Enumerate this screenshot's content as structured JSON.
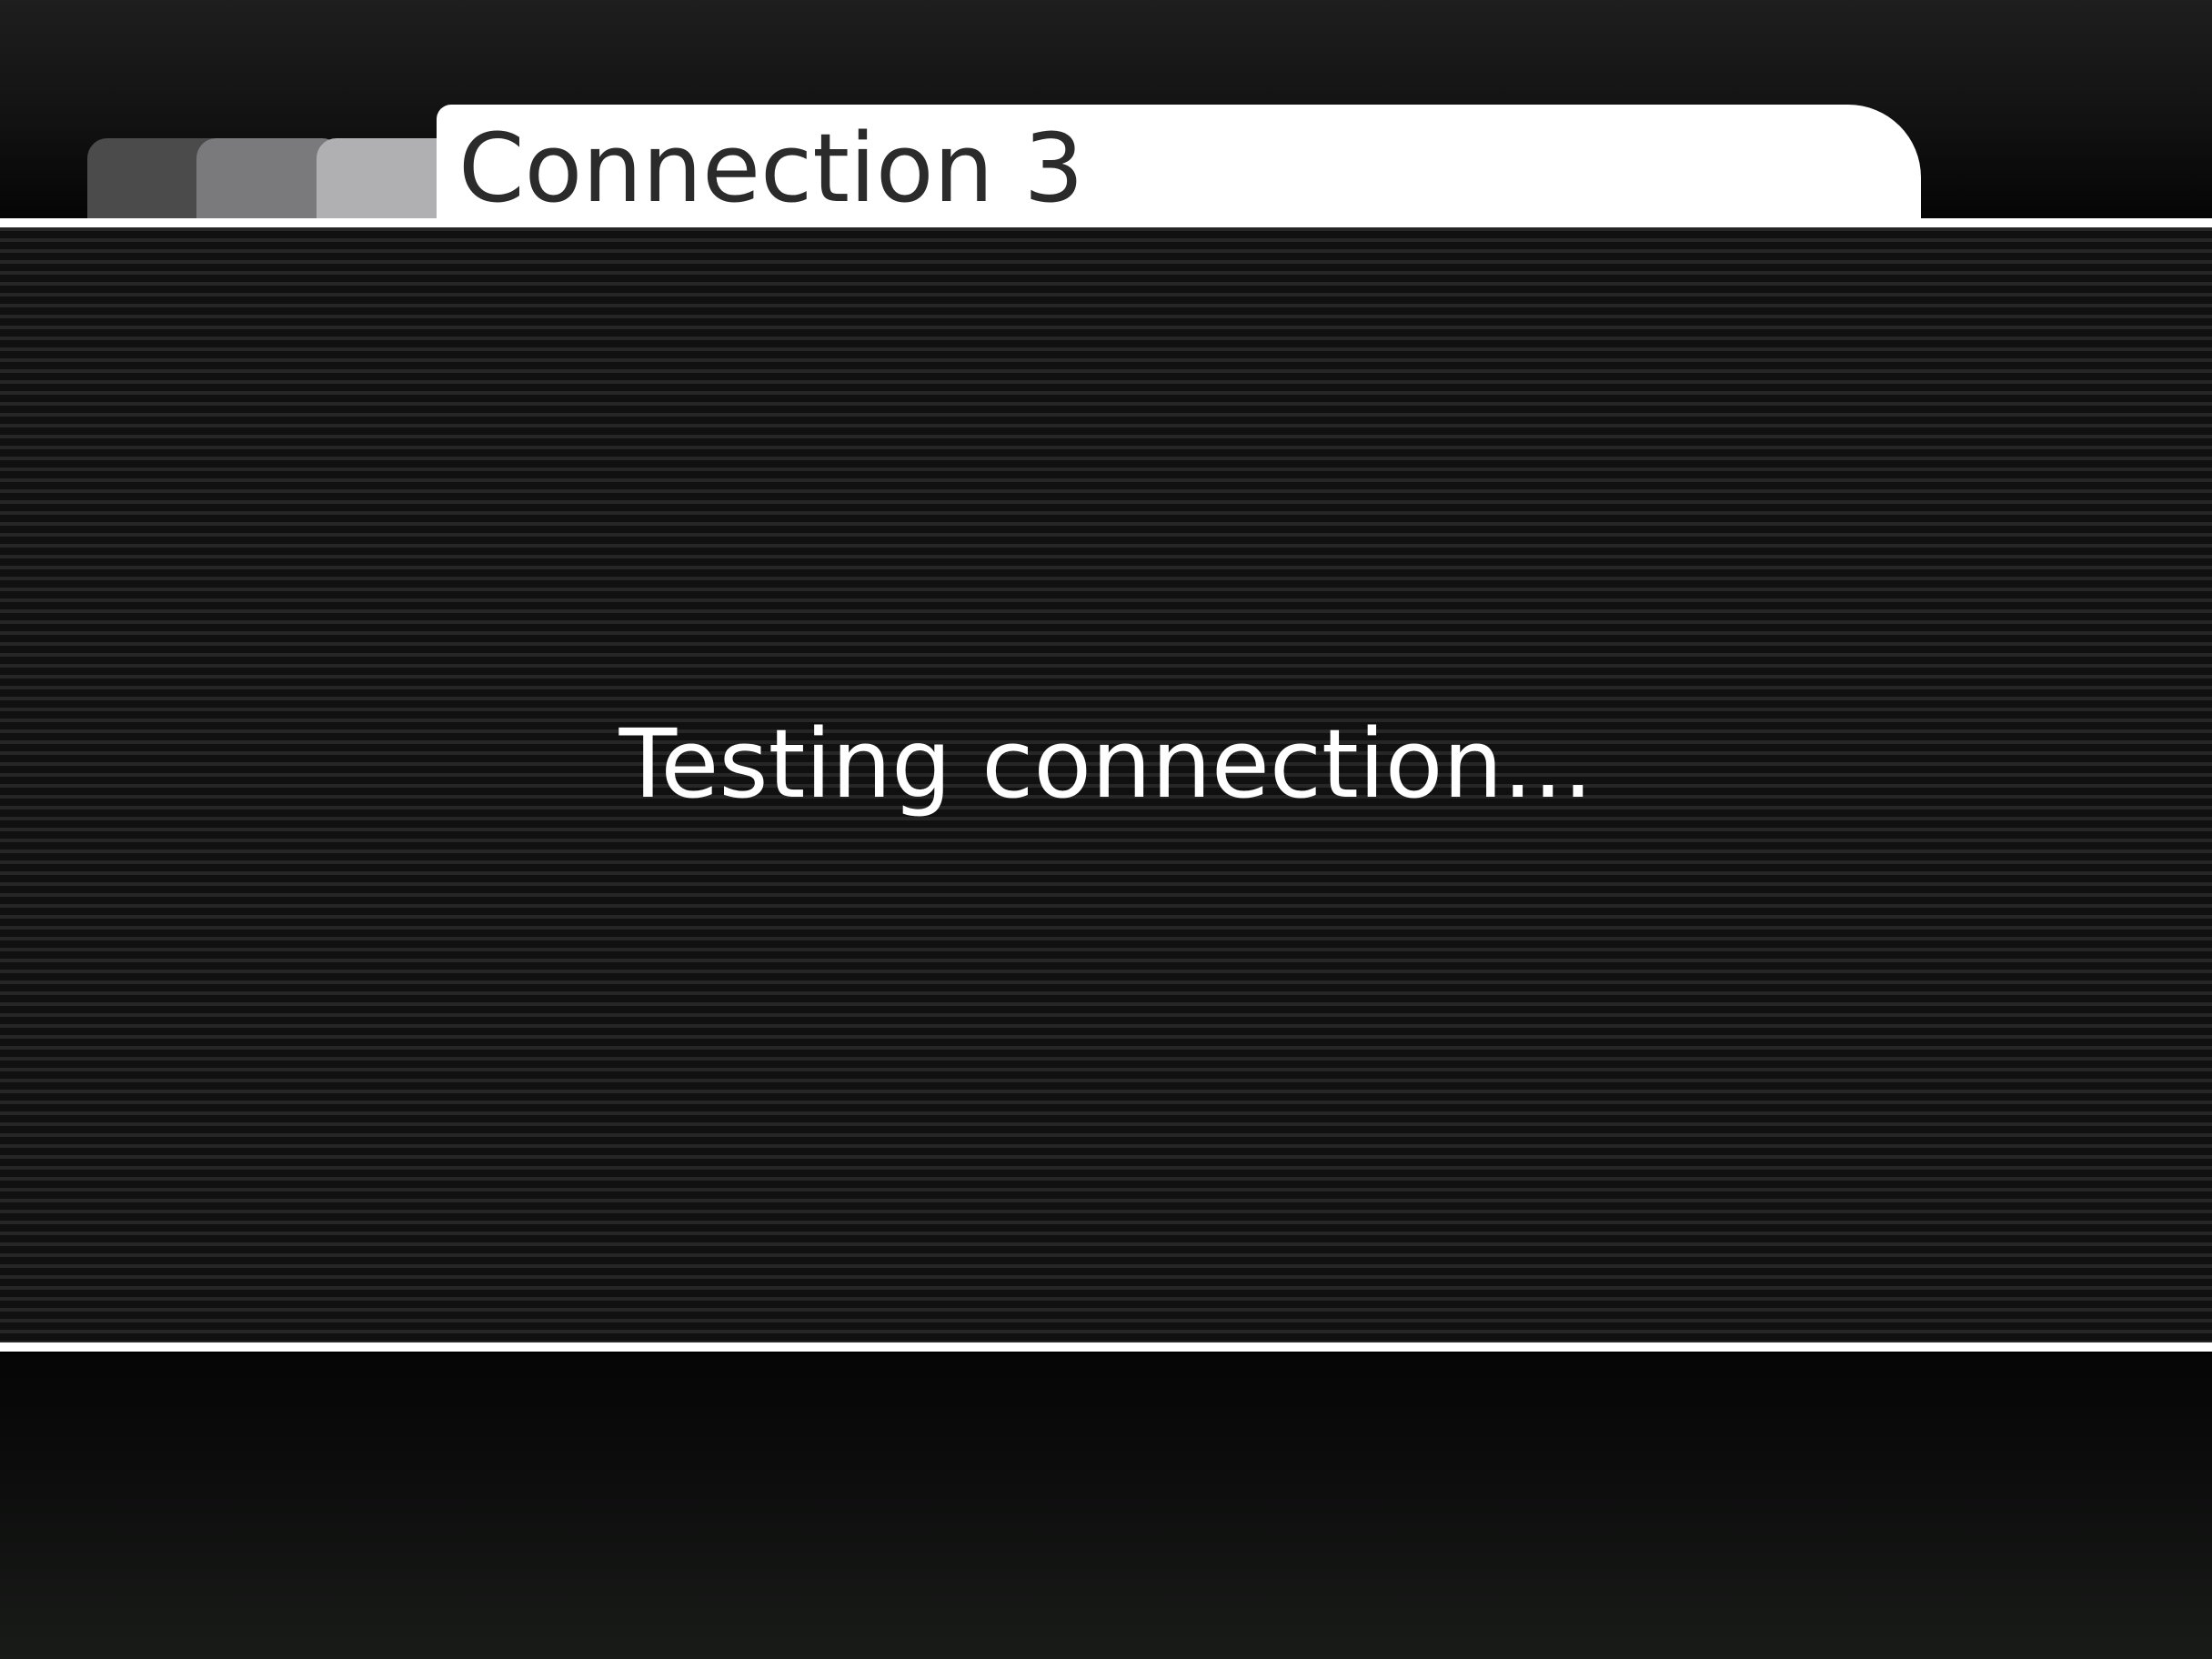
{
  "tab": {
    "title": "Connection 3"
  },
  "status": {
    "message": "Testing connection..."
  },
  "colors": {
    "active_tab": "#ffffff",
    "tab_1": "#4a4b4a",
    "tab_2": "#7a797b",
    "tab_3": "#b0afb2",
    "text_dark": "#2b2b2b",
    "text_light": "#ffffff"
  }
}
